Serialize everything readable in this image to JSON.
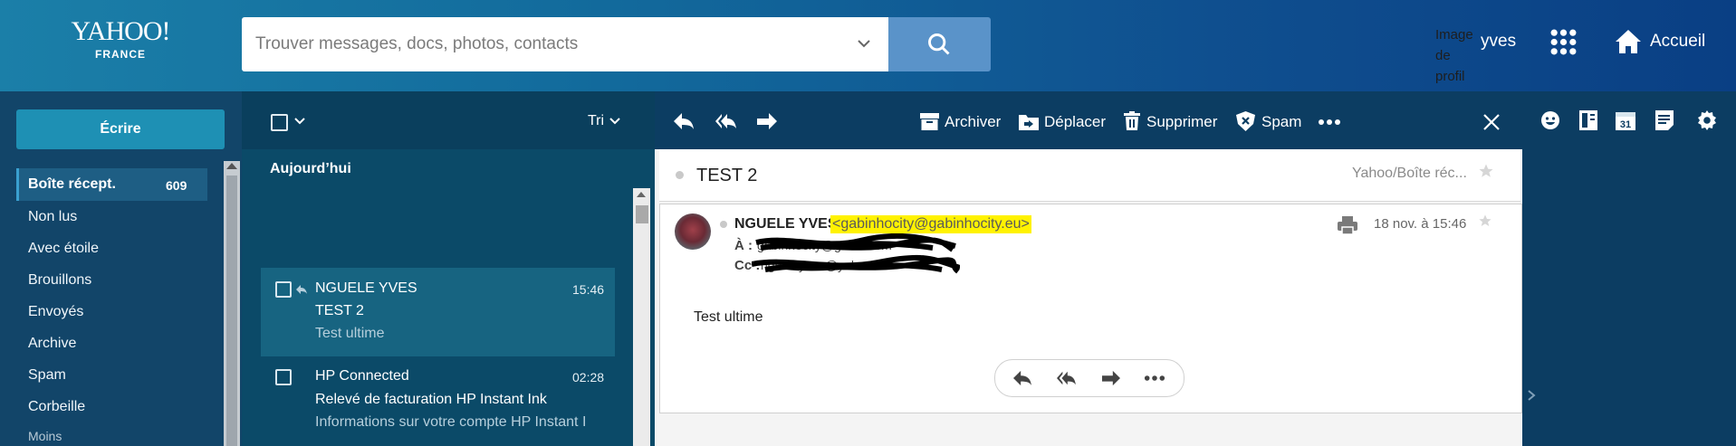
{
  "header": {
    "logo_line1": "YAHOO!",
    "logo_line2": "FRANCE",
    "search_placeholder": "Trouver messages, docs, photos, contacts",
    "profile_image_alt": "Image de profil",
    "user_name": "yves",
    "home_label": "Accueil"
  },
  "sidebar": {
    "compose_label": "Écrire",
    "inbox_label": "Boîte récept.",
    "inbox_count": "609",
    "items": [
      "Non lus",
      "Avec étoile",
      "Brouillons",
      "Envoyés",
      "Archive",
      "Spam",
      "Corbeille"
    ],
    "less_label": "Moins"
  },
  "list": {
    "sort_label": "Tri",
    "section_today": "Aujourd’hui",
    "messages": [
      {
        "sender": "NGUELE YVES",
        "subject": "TEST 2",
        "preview": "Test ultime",
        "time": "15:46",
        "replied": true
      },
      {
        "sender": "HP Connected",
        "subject": "Relevé de facturation HP Instant Ink",
        "preview": "Informations sur votre compte HP Instant I",
        "time": "02:28",
        "replied": false
      }
    ]
  },
  "toolbar": {
    "archive_label": "Archiver",
    "move_label": "Déplacer",
    "delete_label": "Supprimer",
    "spam_label": "Spam"
  },
  "message": {
    "subject": "TEST 2",
    "folder": "Yahoo/Boîte réc...",
    "sender_name": "NGUELE YVES",
    "sender_email": "<gabinhocity@gabinhocity.eu>",
    "to_label": "À :",
    "to_value": "gabinhocity@gmail.com",
    "cc_label": "Cc :",
    "cc_value": "ngueleyves@yahoo.fr",
    "date": "18 nov. à 15:46",
    "body": "Test ultime"
  },
  "colors": {
    "highlight": "#fff200",
    "accent": "#1e90b4",
    "header_start": "#1b7fa8",
    "header_end": "#0a3f84"
  },
  "icons": {
    "search": "search-icon",
    "apps": "apps-grid-icon",
    "home": "home-icon",
    "reply": "reply-icon",
    "reply_all": "reply-all-icon",
    "forward": "forward-icon",
    "close": "close-icon"
  }
}
